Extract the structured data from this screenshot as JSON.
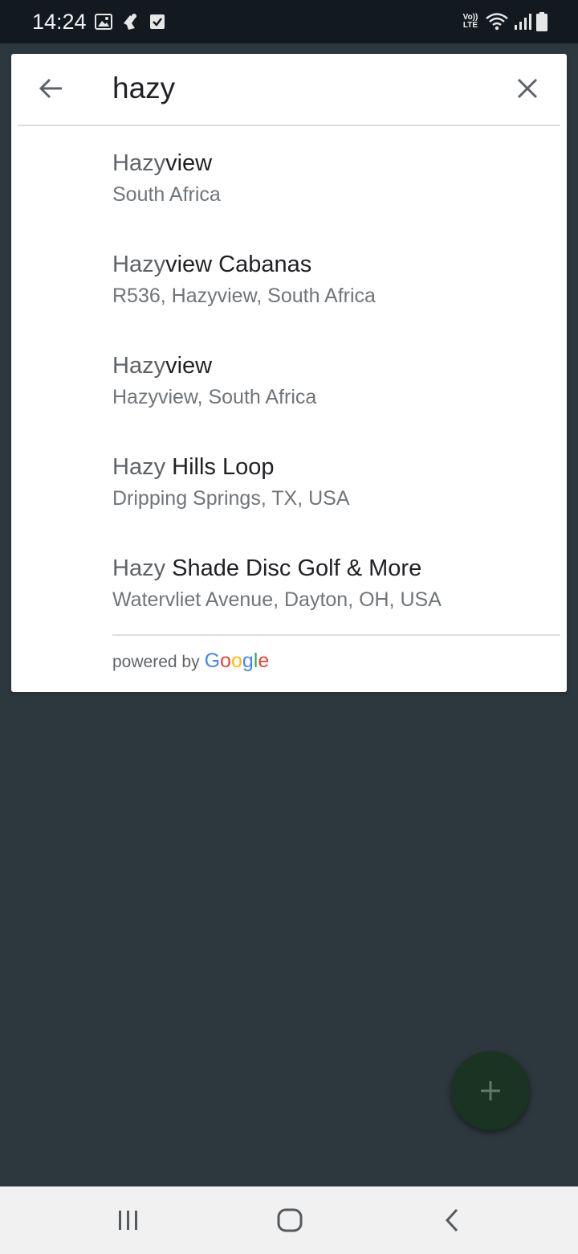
{
  "status_bar": {
    "time": "14:24",
    "left_icons": [
      "image-icon",
      "android-debug-icon",
      "checkbox-icon"
    ],
    "network_label_top": "Vo))",
    "network_label_bottom": "LTE",
    "right_icons": [
      "volte-icon",
      "wifi-icon",
      "signal-icon",
      "battery-icon"
    ]
  },
  "search": {
    "query": "hazy",
    "back_icon": "arrow-left-icon",
    "clear_icon": "close-icon"
  },
  "results": [
    {
      "match": "Hazy",
      "rest": "view",
      "secondary": "South Africa"
    },
    {
      "match": "Hazy",
      "rest": "view Cabanas",
      "secondary": "R536, Hazyview, South Africa"
    },
    {
      "match": "Hazy",
      "rest": "view",
      "secondary": "Hazyview, South Africa"
    },
    {
      "match": "Hazy",
      "rest": " Hills Loop",
      "secondary": "Dripping Springs, TX, USA"
    },
    {
      "match": "Hazy",
      "rest": " Shade Disc Golf & More",
      "secondary": "Watervliet Avenue, Dayton, OH, USA"
    }
  ],
  "attribution": {
    "text": "powered by",
    "logo": [
      "G",
      "o",
      "o",
      "g",
      "l",
      "e"
    ],
    "logo_colors": [
      "#4285f4",
      "#ea4335",
      "#fbbc05",
      "#4285f4",
      "#34a853",
      "#ea4335"
    ]
  },
  "fab": {
    "icon": "plus-icon",
    "color": "#1a3322"
  },
  "nav_bar": {
    "icons": [
      "recent-apps-icon",
      "home-icon",
      "back-icon"
    ]
  },
  "colors": {
    "background": "#2d383e",
    "status_bar": "#131a1f",
    "card": "#ffffff",
    "nav_bar": "#f1f1f1"
  }
}
